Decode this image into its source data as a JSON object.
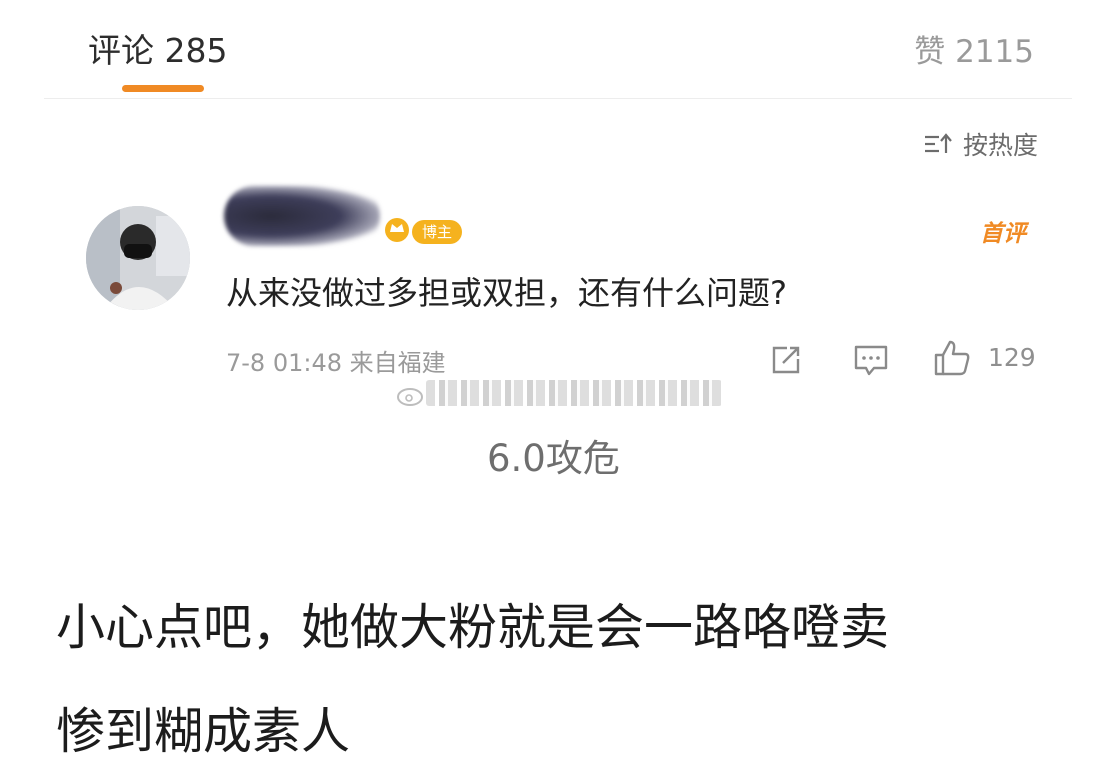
{
  "header": {
    "comments_label": "评论 285",
    "likes_label": "赞 2115"
  },
  "sort": {
    "label": "按热度",
    "icon": "sort-icon"
  },
  "comment": {
    "author_badge": "博主",
    "first_badge": "首评",
    "text": "从来没做过多担或双担，还有什么问题?",
    "meta": "7-8 01:48 来自福建",
    "like_count": "129",
    "actions": [
      "share-icon",
      "reply-icon",
      "thumbs-up-icon"
    ]
  },
  "overlay": {
    "caption": "6.0攻危",
    "line1": "小心点吧，她做大粉就是会一路咯噔卖",
    "line2": "惨到糊成素人"
  },
  "colors": {
    "accent": "#f08a24",
    "badge": "#f5b21e",
    "muted": "#9a9a9a"
  }
}
